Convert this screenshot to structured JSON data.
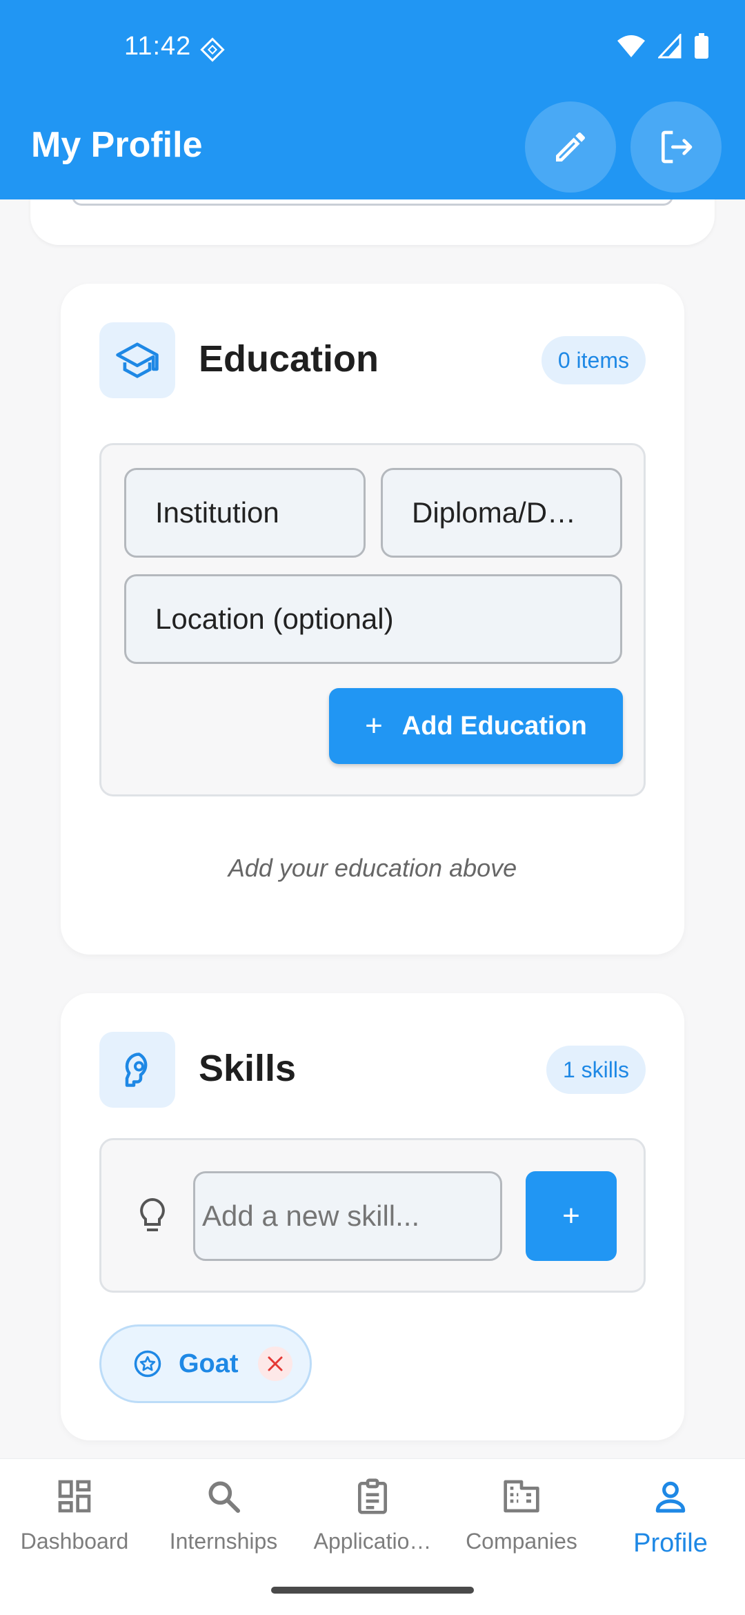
{
  "status_bar": {
    "time": "11:42"
  },
  "app_bar": {
    "title": "My Profile",
    "edit_icon": "pencil-icon",
    "logout_icon": "logout-icon"
  },
  "education": {
    "title": "Education",
    "badge": "0 items",
    "fields": {
      "institution": "Institution",
      "diploma": "Diploma/D…",
      "location": "Location (optional)"
    },
    "add_button": "Add Education",
    "hint": "Add your education above"
  },
  "skills": {
    "title": "Skills",
    "badge": "1 skills",
    "input_placeholder": "Add a new skill...",
    "add_button_symbol": "+",
    "chips": [
      {
        "label": "Goat"
      }
    ]
  },
  "bottom_nav": {
    "items": [
      {
        "label": "Dashboard",
        "icon": "dashboard-icon"
      },
      {
        "label": "Internships",
        "icon": "search-icon"
      },
      {
        "label": "Applicatio…",
        "icon": "clipboard-icon"
      },
      {
        "label": "Companies",
        "icon": "building-icon"
      },
      {
        "label": "Profile",
        "icon": "person-icon"
      }
    ],
    "active": "Profile"
  },
  "colors": {
    "primary": "#2196f3",
    "primary_light": "#e3f0fd",
    "error": "#e53935"
  }
}
